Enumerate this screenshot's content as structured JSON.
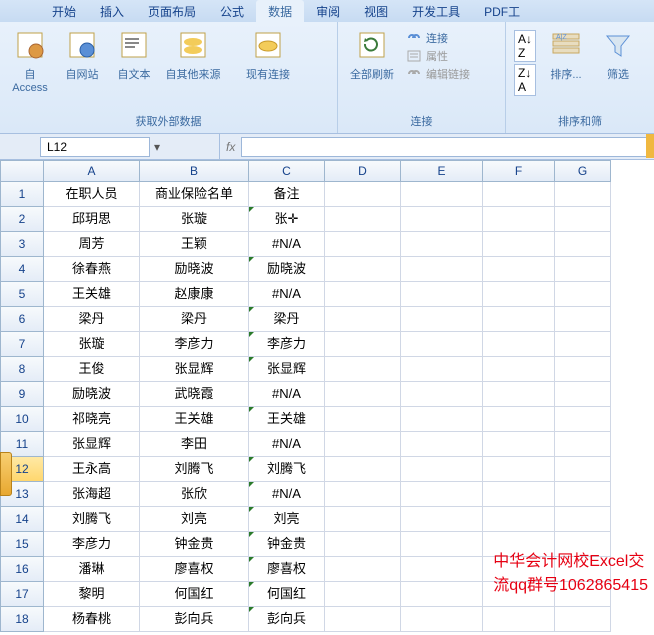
{
  "tabs": [
    {
      "label": "开始",
      "active": false
    },
    {
      "label": "插入",
      "active": false
    },
    {
      "label": "页面布局",
      "active": false
    },
    {
      "label": "公式",
      "active": false
    },
    {
      "label": "数据",
      "active": true
    },
    {
      "label": "审阅",
      "active": false
    },
    {
      "label": "视图",
      "active": false
    },
    {
      "label": "开发工具",
      "active": false
    },
    {
      "label": "PDF工",
      "active": false
    }
  ],
  "ribbon": {
    "ext_data": {
      "access": "自 Access",
      "web": "自网站",
      "text": "自文本",
      "other": "自其他来源",
      "existing": "现有连接",
      "group_label": "获取外部数据"
    },
    "conn": {
      "refresh": "全部刷新",
      "connections": "连接",
      "properties": "属性",
      "edit": "编辑链接",
      "group_label": "连接"
    },
    "sort": {
      "sort": "排序...",
      "filter": "筛选",
      "group_label": "排序和筛"
    }
  },
  "namebox": "L12",
  "fx_label": "fx",
  "columns": [
    "A",
    "B",
    "C",
    "D",
    "E",
    "F",
    "G"
  ],
  "headers": {
    "A": "在职人员",
    "B": "商业保险名单",
    "C": "备注"
  },
  "rows": [
    {
      "n": 2,
      "A": "邱玥思",
      "B": "张璇",
      "C": "张璇",
      "flag": true,
      "cursor": true
    },
    {
      "n": 3,
      "A": "周芳",
      "B": "王颖",
      "C": "#N/A"
    },
    {
      "n": 4,
      "A": "徐春燕",
      "B": "励晓波",
      "C": "励晓波",
      "flag": true
    },
    {
      "n": 5,
      "A": "王关雄",
      "B": "赵康康",
      "C": "#N/A"
    },
    {
      "n": 6,
      "A": "梁丹",
      "B": "梁丹",
      "C": "梁丹",
      "flag": true
    },
    {
      "n": 7,
      "A": "张璇",
      "B": "李彦力",
      "C": "李彦力",
      "flag": true
    },
    {
      "n": 8,
      "A": "王俊",
      "B": "张显辉",
      "C": "张显辉",
      "flag": true
    },
    {
      "n": 9,
      "A": "励晓波",
      "B": "武晓霞",
      "C": "#N/A"
    },
    {
      "n": 10,
      "A": "祁晓亮",
      "B": "王关雄",
      "C": "王关雄",
      "flag": true
    },
    {
      "n": 11,
      "A": "张显辉",
      "B": "李田",
      "C": "#N/A"
    },
    {
      "n": 12,
      "A": "王永高",
      "B": "刘腾飞",
      "C": "刘腾飞",
      "flag": true,
      "sel": true
    },
    {
      "n": 13,
      "A": "张海超",
      "B": "张欣",
      "C": "#N/A",
      "flag": true
    },
    {
      "n": 14,
      "A": "刘腾飞",
      "B": "刘亮",
      "C": "刘亮",
      "flag": true
    },
    {
      "n": 15,
      "A": "李彦力",
      "B": "钟金贵",
      "C": "钟金贵",
      "flag": true
    },
    {
      "n": 16,
      "A": "潘琳",
      "B": "廖喜权",
      "C": "廖喜权",
      "flag": true
    },
    {
      "n": 17,
      "A": "黎明",
      "B": "何国红",
      "C": "何国红",
      "flag": true
    },
    {
      "n": 18,
      "A": "杨春桃",
      "B": "彭向兵",
      "C": "彭向兵",
      "flag": true
    }
  ],
  "watermark": {
    "l1": "中华会计网校Excel交",
    "l2": "流qq群号1062865415"
  }
}
